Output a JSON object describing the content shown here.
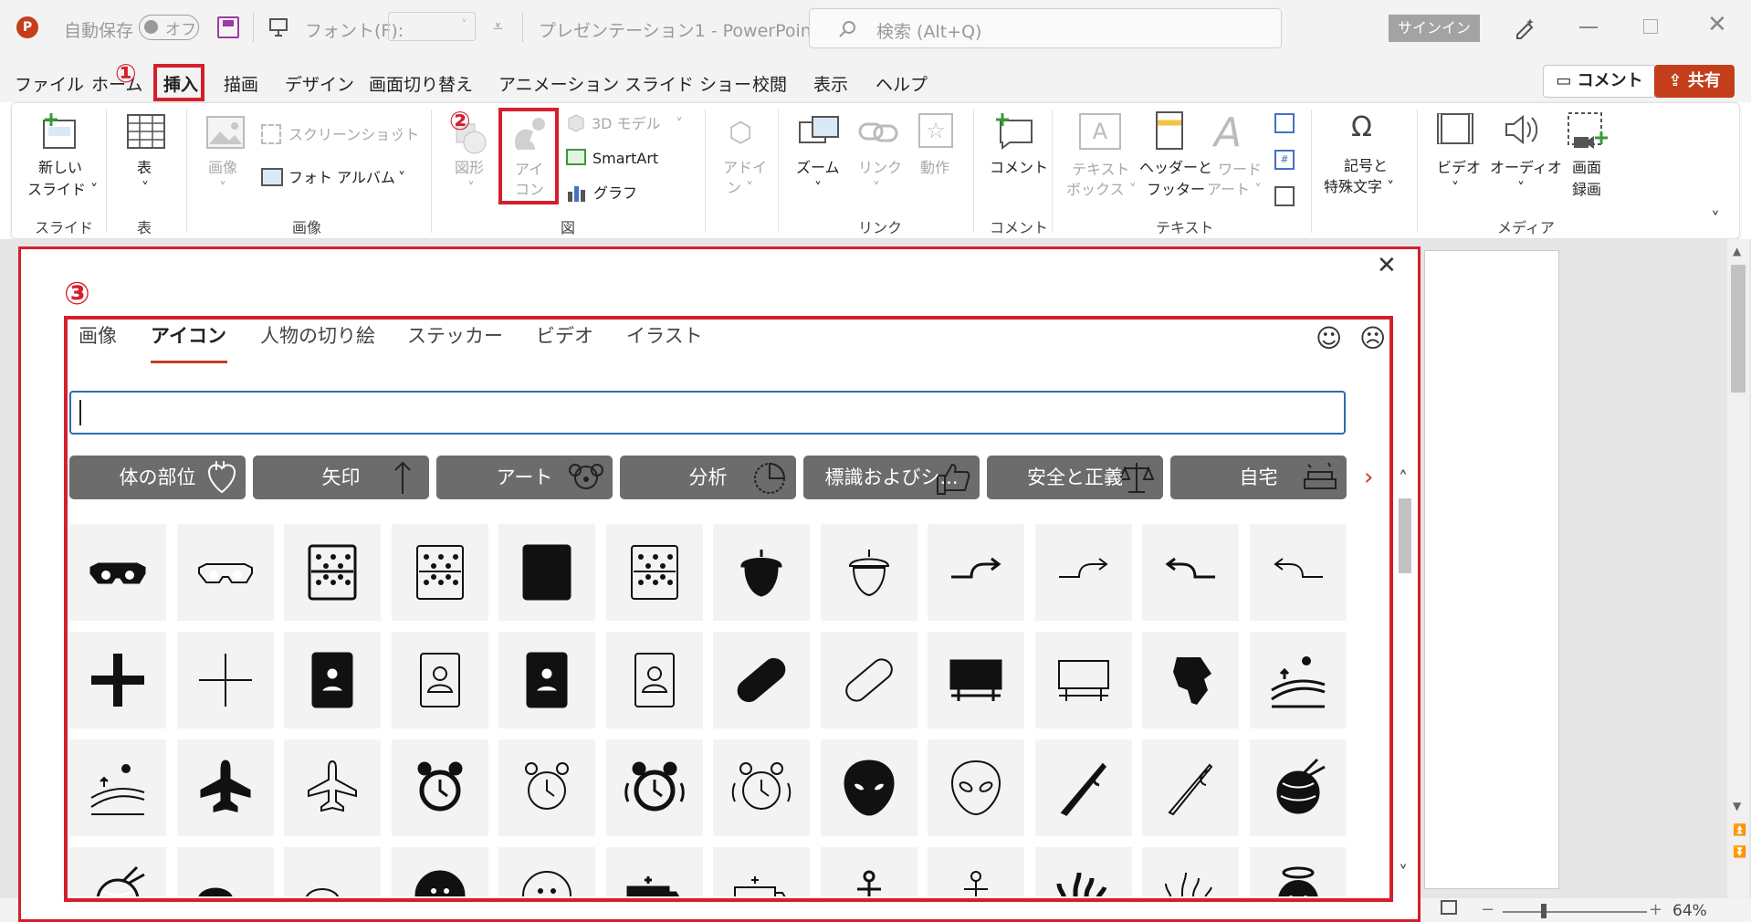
{
  "titlebar": {
    "autosave_label": "自動保存",
    "autosave_state": "オフ",
    "font_label": "フォント(F):",
    "doc_title": "プレゼンテーション1 - PowerPoint",
    "search_placeholder": "検索 (Alt+Q)",
    "signin": "サインイン"
  },
  "menu": {
    "tabs": [
      "ファイル",
      "ホーム",
      "挿入",
      "描画",
      "デザイン",
      "画面切り替え",
      "アニメーション",
      "スライド ショー",
      "校閲",
      "表示",
      "ヘルプ"
    ],
    "comment_btn": "コメント",
    "share_btn": "共有"
  },
  "ribbon": {
    "new_slide": [
      "新しい",
      "スライド ˅"
    ],
    "table": "表",
    "image": "画像",
    "screenshot": "スクリーンショット",
    "photo_album": "フォト アルバム",
    "shapes": "図形",
    "icons": [
      "アイ",
      "コン"
    ],
    "model3d": "3D モデル",
    "smartart": "SmartArt",
    "graph": "グラフ",
    "addin": [
      "アドイ",
      "ン ˅"
    ],
    "zoom": "ズーム",
    "link": "リンク",
    "action": "動作",
    "comment": "コメント",
    "textbox": [
      "テキスト",
      "ボックス ˅"
    ],
    "headerfooter": [
      "ヘッダーと",
      "フッター"
    ],
    "wordart": [
      "ワード",
      "アート ˅"
    ],
    "symbols": [
      "記号と",
      "特殊文字 ˅"
    ],
    "video": "ビデオ",
    "audio": "オーディオ",
    "record": [
      "画面",
      "録画"
    ],
    "groups": [
      "スライド",
      "表",
      "画像",
      "図",
      "リンク",
      "コメント",
      "テキスト",
      "メディア"
    ]
  },
  "annotations": [
    "①",
    "②",
    "③"
  ],
  "dialog": {
    "tabs": [
      "画像",
      "アイコン",
      "人物の切り絵",
      "ステッカー",
      "ビデオ",
      "イラスト"
    ],
    "active_tab": "アイコン",
    "search_value": "",
    "categories": [
      "体の部位",
      "矢印",
      "アート",
      "分析",
      "標識およびシ...",
      "安全と正義",
      "自宅"
    ],
    "icons": [
      "3d-glasses-filled",
      "3d-glasses-outline",
      "abacus-filled",
      "abacus-outline",
      "abacus-dark-filled",
      "abacus-dark-outline",
      "acorn-filled",
      "acorn-outline",
      "arrow-right-curve-filled",
      "arrow-right-curve-outline",
      "arrow-left-curve-filled",
      "arrow-left-curve-outline",
      "plus-filled",
      "plus-outline",
      "address-book-filled",
      "address-book-outline",
      "contact-book-filled",
      "contact-book-outline",
      "bandage-filled",
      "bandage-outline",
      "billboard-filled",
      "billboard-outline",
      "africa-filled",
      "fields-filled",
      "fields-outline",
      "airplane-filled",
      "airplane-outline",
      "alarm-clock-filled",
      "alarm-clock-outline",
      "alarm-ringing-filled",
      "alarm-ringing-outline",
      "alien-filled",
      "alien-outline",
      "needle-filled",
      "needle-outline",
      "yarn-filled",
      "yarn-knit",
      "measuring-tape-filled",
      "measuring-tape-outline",
      "button-filled",
      "button-outline",
      "ambulance-filled",
      "ambulance-outline",
      "anchor-filled",
      "anchor-outline",
      "coral-filled",
      "coral-outline",
      "angel-face-filled"
    ]
  },
  "status": {
    "zoom": "64%"
  }
}
